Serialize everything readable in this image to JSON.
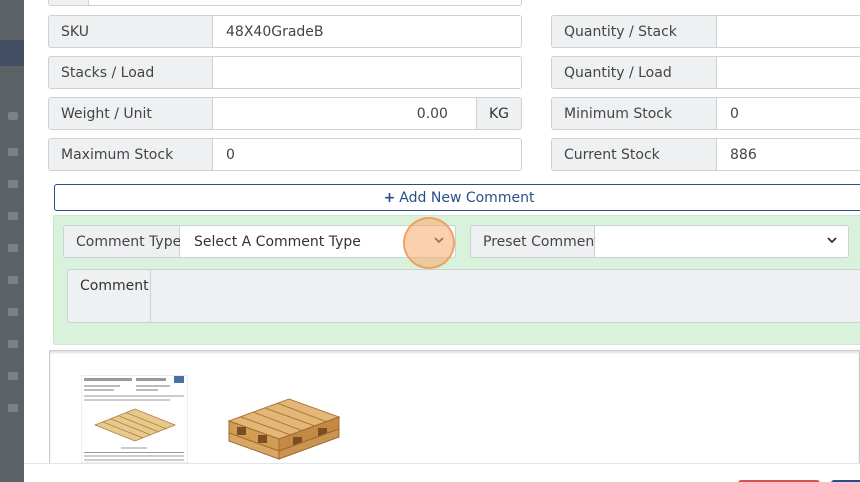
{
  "form": {
    "sku": {
      "label": "SKU",
      "value": "48X40GradeB"
    },
    "stacks_load": {
      "label": "Stacks / Load",
      "value": ""
    },
    "weight_unit": {
      "label": "Weight / Unit",
      "value": "0.00",
      "unit": "KG"
    },
    "maximum_stock": {
      "label": "Maximum Stock",
      "value": "0"
    },
    "quantity_stack": {
      "label": "Quantity / Stack",
      "value": ""
    },
    "quantity_load": {
      "label": "Quantity / Load",
      "value": ""
    },
    "minimum_stock": {
      "label": "Minimum Stock",
      "value": "0"
    },
    "current_stock": {
      "label": "Current Stock",
      "value": "886"
    }
  },
  "comments": {
    "add_label": "Add New Comment",
    "comment_type_label": "Comment Type",
    "comment_type_value": "Select A Comment Type",
    "preset_comment_label": "Preset Comment",
    "preset_comment_value": "",
    "comment_label": "Comment"
  },
  "colors": {
    "accent": "#2a4e8a",
    "comment_bg": "#d9f2db",
    "danger": "#d9534f"
  }
}
